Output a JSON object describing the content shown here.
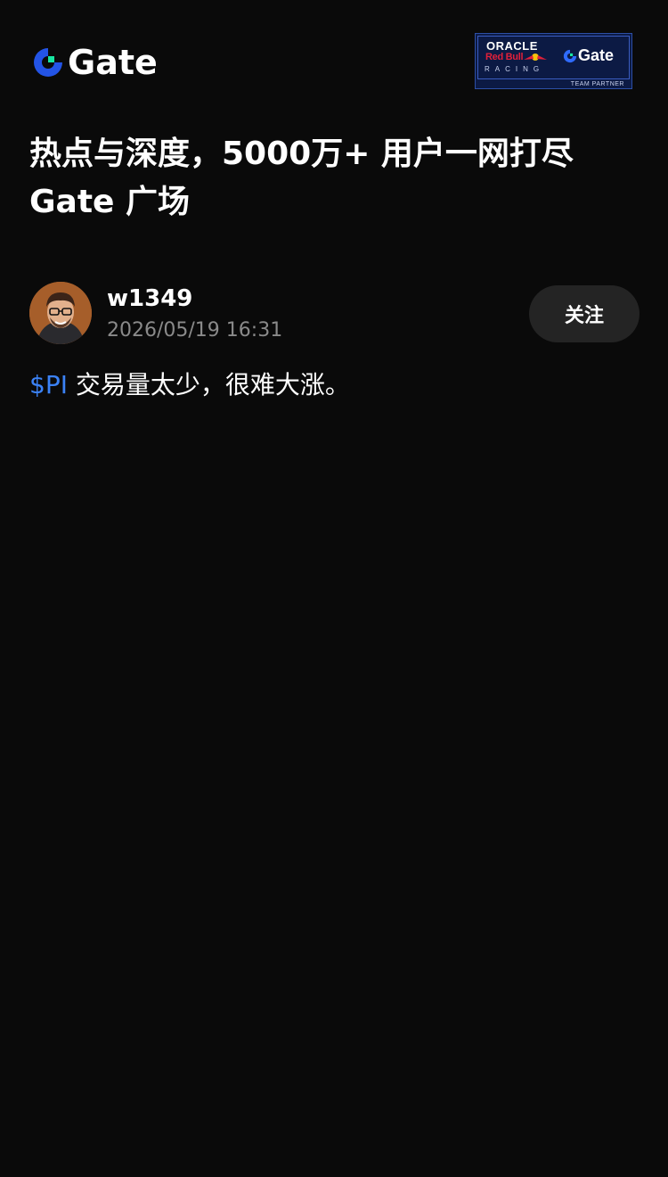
{
  "header": {
    "brand_name": "Gate",
    "brand_icon": "gate-logo-icon",
    "partner": {
      "line1": "ORACLE",
      "line2": "Red Bull",
      "line3": "RACING",
      "gate": "Gate",
      "footer": "TEAM PARTNER"
    }
  },
  "headline": {
    "line1": "热点与深度，5000万+ 用户一网打尽",
    "line2": "Gate 广场"
  },
  "post": {
    "author": {
      "name": "w1349",
      "avatar_icon": "user-avatar"
    },
    "timestamp": "2026/05/19 16:31",
    "follow_label": "关注",
    "ticker": "$PI",
    "text": "交易量太少，很难大涨。"
  },
  "colors": {
    "background": "#0a0a0a",
    "ticker_blue": "#3b82f6",
    "brand_blue": "#2354e6",
    "brand_green": "#17e6a1",
    "muted_text": "#8a8a8a",
    "button_bg": "#242424"
  }
}
